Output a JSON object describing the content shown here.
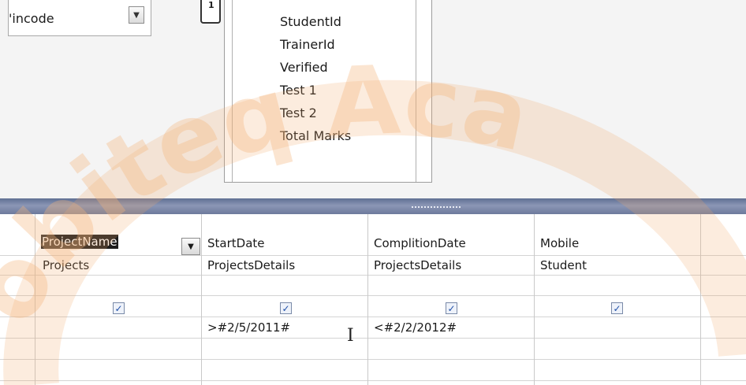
{
  "upper": {
    "field_box": {
      "value": "Pincode",
      "visible_text": "'incode"
    },
    "relationship_marker": "1",
    "table": {
      "fields": [
        "StudentId",
        "TrainerId",
        "Verified",
        "Test 1",
        "Test 2",
        "Total Marks"
      ]
    }
  },
  "grid": {
    "columns": [
      {
        "field": "ProjectName",
        "table": "Projects",
        "show": true,
        "criteria": ""
      },
      {
        "field": "StartDate",
        "table": "ProjectsDetails",
        "show": true,
        "criteria": ">#2/5/2011#"
      },
      {
        "field": "ComplitionDate",
        "table": "ProjectsDetails",
        "show": true,
        "criteria": "<#2/2/2012#"
      },
      {
        "field": "Mobile",
        "table": "Student",
        "show": true,
        "criteria": ""
      }
    ]
  },
  "icons": {
    "dropdown": "chevron-down-icon",
    "checkbox": "check-icon",
    "cursor": "text-cursor-icon"
  },
  "watermark": {
    "text": "obiteq Aca",
    "color": "#f3b57c"
  },
  "colors": {
    "splitter": "#6d7a9c",
    "selection": "#1c1c1c",
    "checkmark": "#1f4fa8"
  }
}
